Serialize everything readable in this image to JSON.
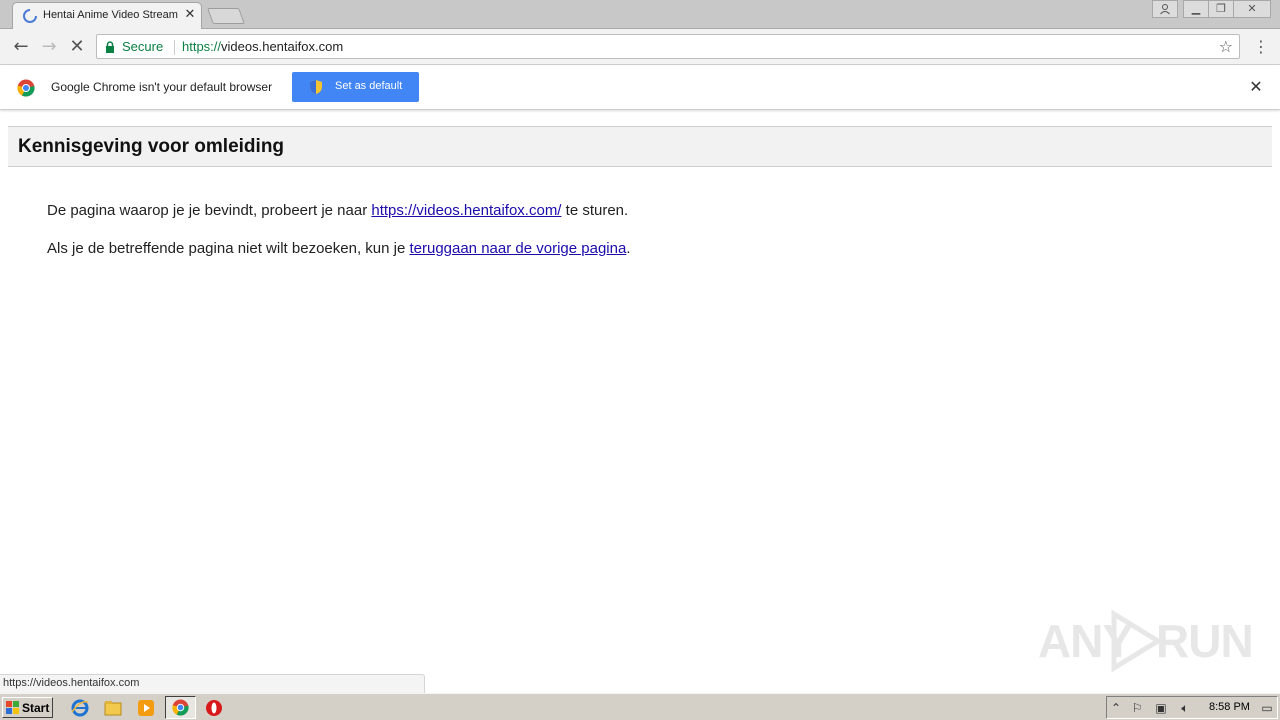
{
  "browser": {
    "tab": {
      "title": "Hentai Anime Video Streamin"
    },
    "address": {
      "secure_label": "Secure",
      "url_scheme": "https://",
      "url_host": "videos.hentaifox.com"
    },
    "infobar": {
      "message": "Google Chrome isn't your default browser",
      "button_label": "Set as default"
    }
  },
  "page": {
    "title": "Kennisgeving voor omleiding",
    "para1": {
      "before": "De pagina waarop je je bevindt, probeert je naar ",
      "link": "https://videos.hentaifox.com/",
      "after": " te sturen."
    },
    "para2": {
      "before": "Als je de betreffende pagina niet wilt bezoeken, kun je ",
      "link": "teruggaan naar de vorige pagina",
      "after": "."
    }
  },
  "status_bar": {
    "url": "https://videos.hentaifox.com"
  },
  "watermark": {
    "left": "ANY",
    "right": "RUN"
  },
  "taskbar": {
    "start_label": "Start",
    "clock": "8:58 PM"
  },
  "colors": {
    "link": "#1a0dab",
    "secure": "#0b8043",
    "accent": "#4285f4"
  }
}
